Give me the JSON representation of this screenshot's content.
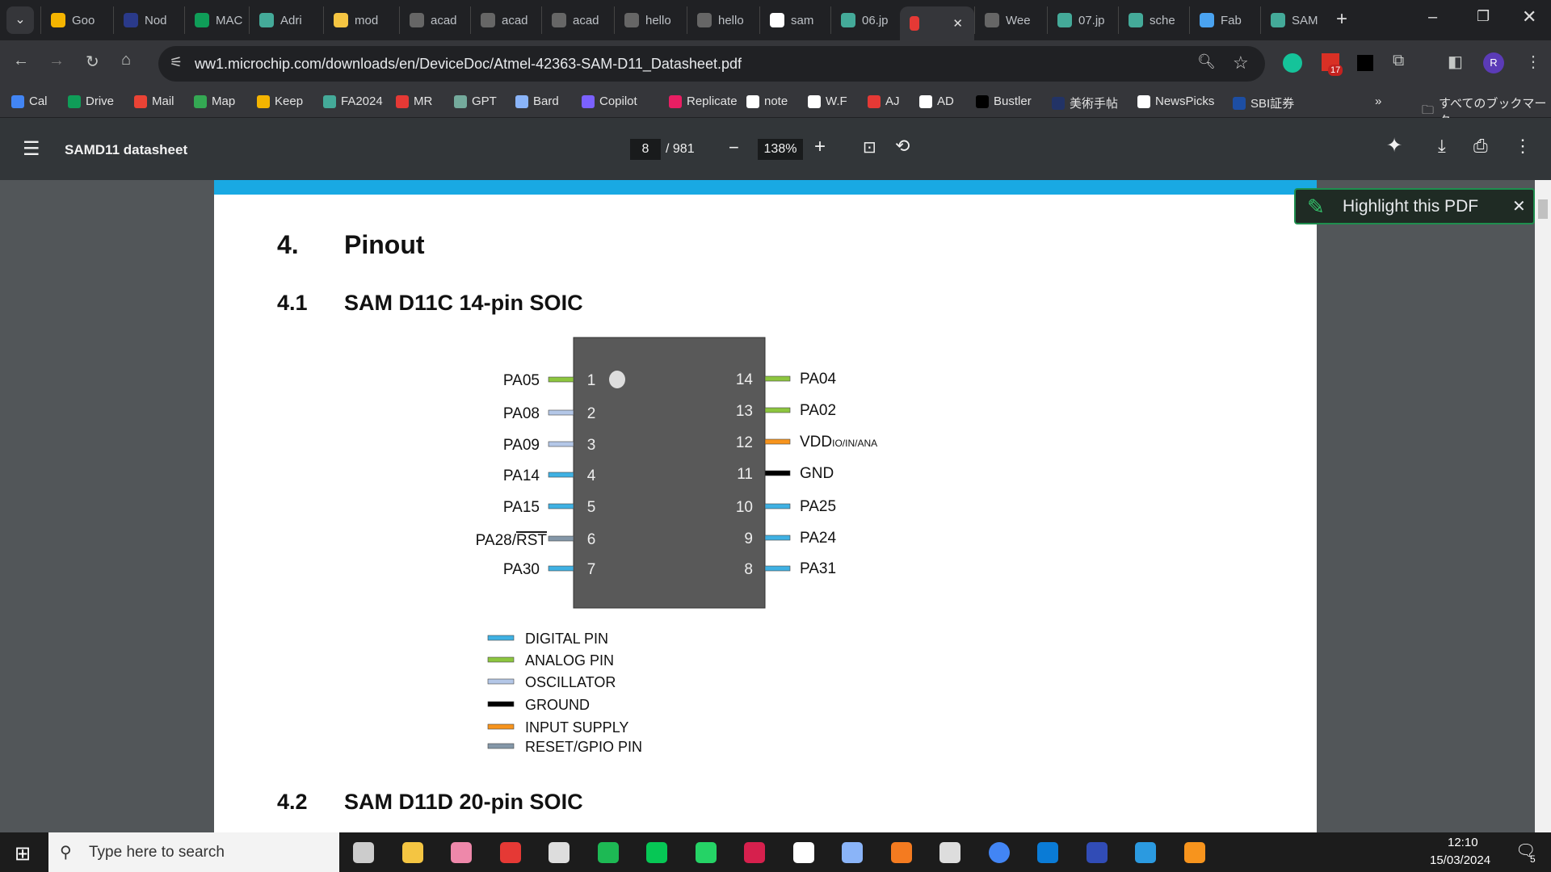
{
  "tabs": [
    "Goo",
    "Nod",
    "MAC",
    "Adri",
    "mod",
    "acad",
    "acad",
    "acad",
    "hello",
    "hello",
    "sam",
    "06.jp",
    "",
    "Wee",
    "07.jp",
    "sche",
    "Fab",
    "SAM"
  ],
  "address": "ww1.microchip.com/downloads/en/DeviceDoc/Atmel-42363-SAM-D11_Datasheet.pdf",
  "extension_badge": "17",
  "profile_initial": "R",
  "bookmarks": [
    "Cal",
    "Drive",
    "Mail",
    "Map",
    "Keep",
    "FA2024",
    "MR",
    "GPT",
    "Bard",
    "Copilot",
    "Replicate",
    "note",
    "W.F",
    "AJ",
    "AD",
    "Bustler",
    "美術手帖",
    "NewsPicks",
    "SBI証券"
  ],
  "all_bookmarks": "すべてのブックマーク",
  "pdf": {
    "title": "SAMD11 datasheet",
    "page": "8",
    "total": "/ 981",
    "zoom": "138%"
  },
  "doc": {
    "h1_num": "4.",
    "h1": "Pinout",
    "h2_num": "4.1",
    "h2": "SAM D11C 14-pin SOIC",
    "h3_num": "4.2",
    "h3": "SAM D11D 20-pin SOIC",
    "colors": {
      "digital": "#3fb1e3",
      "analog": "#8dc63f",
      "oscillator": "#b4c7e7",
      "ground": "#000000",
      "supply": "#f7941d",
      "reset": "#8497a8",
      "chip": "#595959"
    },
    "left_pins": [
      {
        "num": "1",
        "name": "PA05",
        "type": "analog"
      },
      {
        "num": "2",
        "name": "PA08",
        "type": "oscillator"
      },
      {
        "num": "3",
        "name": "PA09",
        "type": "oscillator"
      },
      {
        "num": "4",
        "name": "PA14",
        "type": "digital"
      },
      {
        "num": "5",
        "name": "PA15",
        "type": "digital"
      },
      {
        "num": "6",
        "name": "PA28/",
        "overline": "RST",
        "type": "reset"
      },
      {
        "num": "7",
        "name": "PA30",
        "type": "digital"
      }
    ],
    "right_pins": [
      {
        "num": "14",
        "name": "PA04",
        "type": "analog"
      },
      {
        "num": "13",
        "name": "PA02",
        "type": "analog"
      },
      {
        "num": "12",
        "name": "VDD",
        "sub": "IO/IN/ANA",
        "type": "supply"
      },
      {
        "num": "11",
        "name": "GND",
        "type": "ground"
      },
      {
        "num": "10",
        "name": "PA25",
        "type": "digital"
      },
      {
        "num": "9",
        "name": "PA24",
        "type": "digital"
      },
      {
        "num": "8",
        "name": "PA31",
        "type": "digital"
      }
    ],
    "legend": [
      {
        "label": "DIGITAL PIN",
        "type": "digital"
      },
      {
        "label": "ANALOG PIN",
        "type": "analog"
      },
      {
        "label": "OSCILLATOR",
        "type": "oscillator"
      },
      {
        "label": "GROUND",
        "type": "ground"
      },
      {
        "label": "INPUT SUPPLY",
        "type": "supply"
      },
      {
        "label": "RESET/GPIO PIN",
        "type": "reset"
      }
    ]
  },
  "popup": "Highlight this PDF",
  "taskbar": {
    "search_placeholder": "Type here to search",
    "time": "12:10",
    "date": "15/03/2024",
    "notifications": "5"
  }
}
